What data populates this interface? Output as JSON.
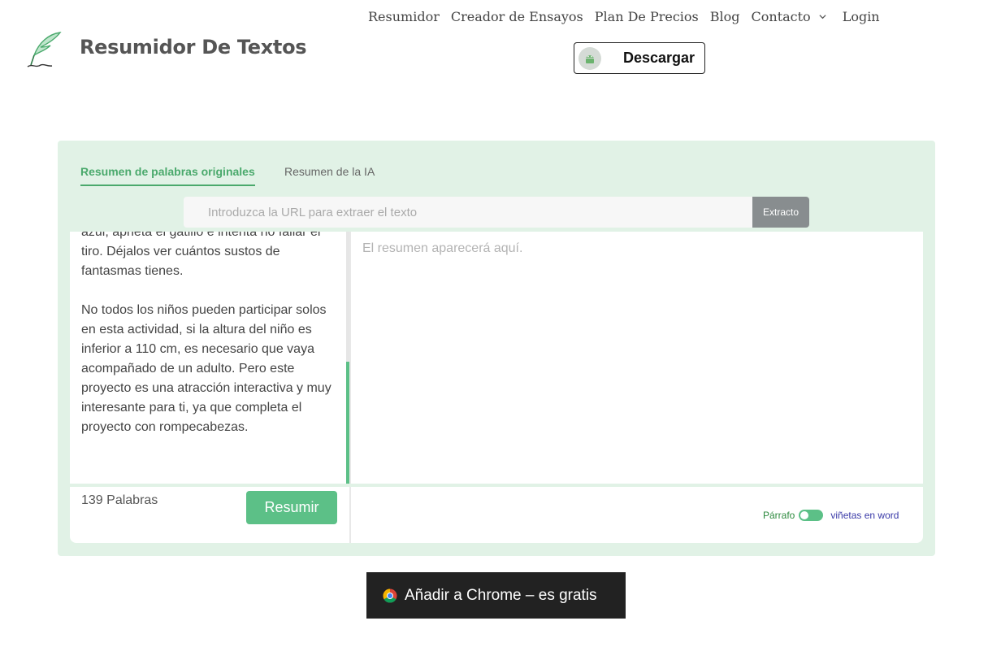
{
  "brand": {
    "name": "Resumidor De Textos",
    "icon": "feather-pen-icon"
  },
  "nav": {
    "items": [
      "Resumidor",
      "Creador de Ensayos",
      "Plan De Precios",
      "Blog",
      "Contacto",
      "Login"
    ],
    "dropdown_icon": "chevron-down-icon"
  },
  "download": {
    "label": "Descargar",
    "icon": "android-icon"
  },
  "tabs": {
    "original": "Resumen de palabras originales",
    "ai": "Resumen de la IA"
  },
  "url_input": {
    "placeholder": "Introduzca la URL para extraer el texto",
    "value": ""
  },
  "extract_label": "Extracto",
  "source_text": "azul, aprieta el gatillo e intenta no fallar el tiro. Déjalos ver cuántos sustos de fantasmas tienes.\n\nNo todos los niños pueden participar solos en esta actividad, si la altura del niño es inferior a 110 cm, es necesario que vaya acompañado de un adulto. Pero este proyecto es una atracción interactiva y muy interesante para ti, ya que completa el proyecto con rompecabezas.",
  "summary_placeholder": "El resumen aparecerá aquí.",
  "word_count": "139 Palabras",
  "summarize_label": "Resumir",
  "toggle": {
    "left_label": "Párrafo",
    "right_label": "viñetas en word"
  },
  "chrome": {
    "label": "Añadir a Chrome – es gratis",
    "icon": "chrome-icon"
  },
  "colors": {
    "accent": "#5cc087",
    "panel_bg": "#e1f2e6",
    "dark_button": "#222222"
  }
}
